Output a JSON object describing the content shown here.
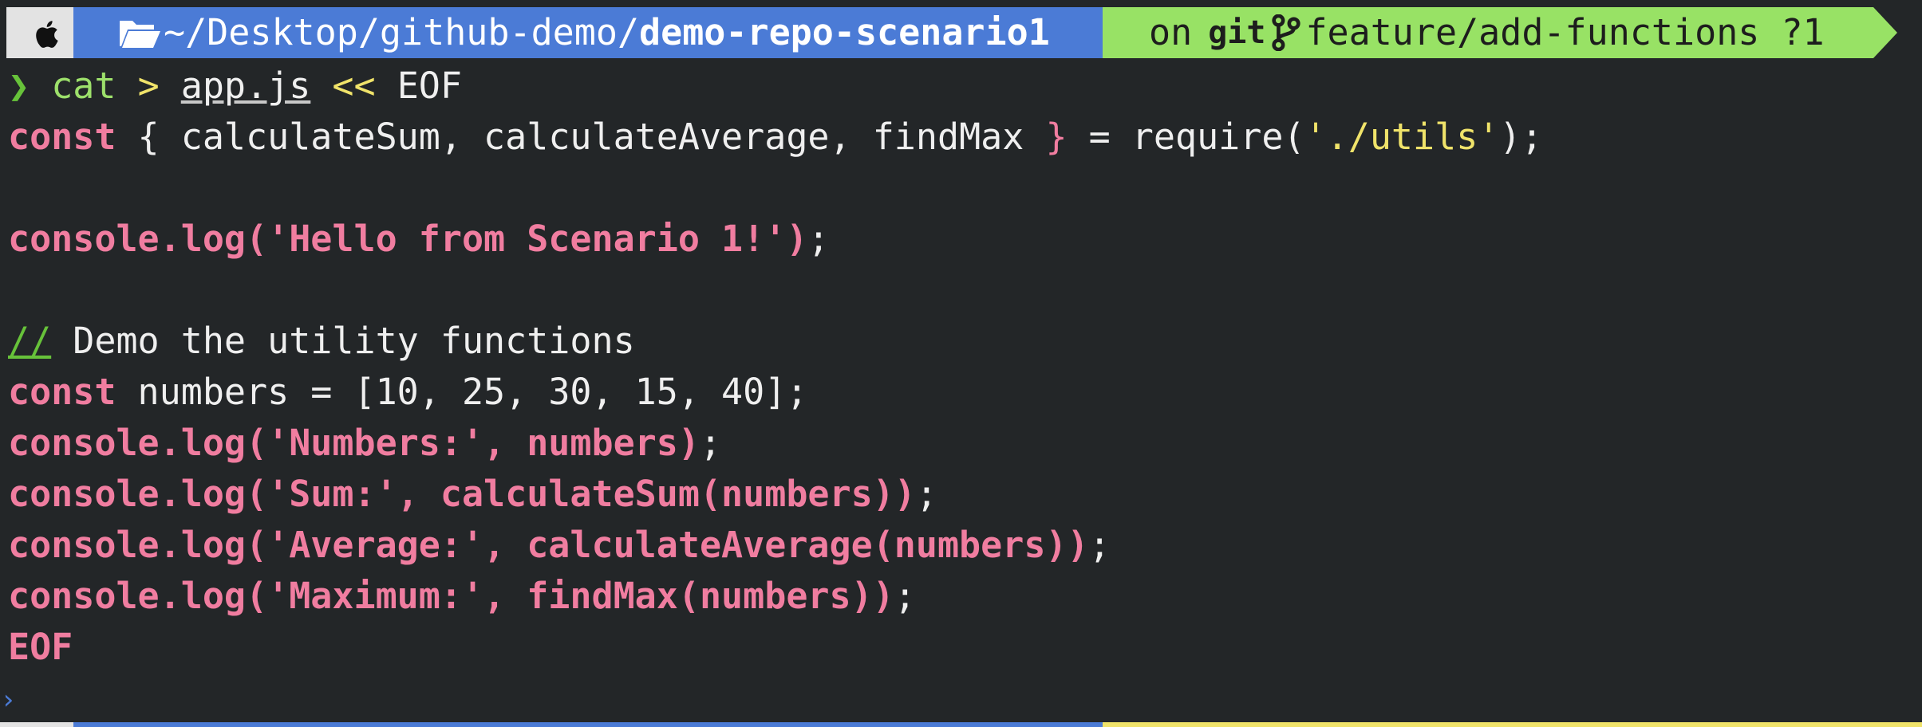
{
  "prompt": {
    "apple_icon": "apple-logo-icon",
    "folder_icon": "folder-open-icon",
    "path_prefix": "~/Desktop/github-demo/",
    "path_current": "demo-repo-scenario1",
    "git_on": "on",
    "git_label": "git",
    "branch_icon": "git-branch-icon",
    "branch": "feature/add-functions ?1"
  },
  "command": {
    "chevron": "❯",
    "cmd": "cat",
    "redirect": ">",
    "file": "app.js",
    "heredoc": "<<",
    "marker": "EOF"
  },
  "lines": [
    {
      "id": "l1",
      "parts": [
        "const",
        " { calculateSum, calculateAverage, findMax ",
        "}",
        " = require(",
        "'./utils'",
        ");"
      ]
    },
    {
      "id": "l2",
      "text": "console.log('Hello from Scenario 1!')",
      "tail": ";"
    },
    {
      "id": "l3",
      "comment": "//",
      "text": " Demo the utility functions"
    },
    {
      "id": "l4",
      "kw": "const",
      "text": " numbers = [10, 25, 30, 15, 40];"
    },
    {
      "id": "l5",
      "text": "console.log('Numbers:', numbers)",
      "tail": ";"
    },
    {
      "id": "l6",
      "text": "console.log('Sum:', calculateSum(numbers))",
      "tail": ";"
    },
    {
      "id": "l7",
      "text": "console.log('Average:', calculateAverage(numbers))",
      "tail": ";"
    },
    {
      "id": "l8",
      "text": "console.log('Maximum:', findMax(numbers))",
      "tail": ";"
    },
    {
      "id": "l9",
      "text": "EOF"
    }
  ],
  "colors": {
    "background": "#232628",
    "path_segment": "#4b7bd6",
    "git_segment": "#98e265",
    "keyword": "#f07da0",
    "string_yellow": "#f0e36a",
    "prompt_green": "#67c23a"
  }
}
